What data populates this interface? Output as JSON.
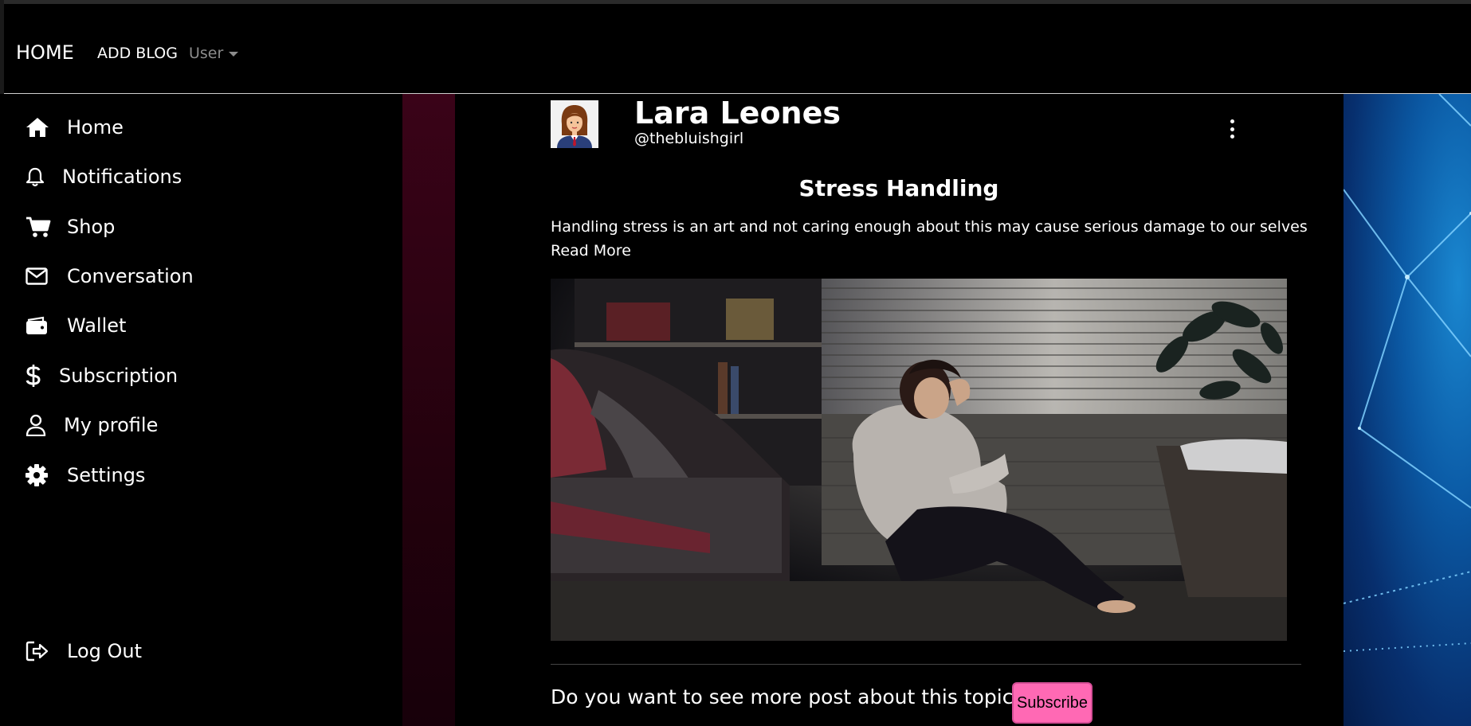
{
  "navbar": {
    "home_label": "HOME",
    "add_blog_label": "ADD BLOG",
    "user_menu_label": "User"
  },
  "sidebar": {
    "items": [
      {
        "label": "Home",
        "icon": "home-icon"
      },
      {
        "label": "Notifications",
        "icon": "bell-icon"
      },
      {
        "label": "Shop",
        "icon": "cart-icon"
      },
      {
        "label": "Conversation",
        "icon": "envelope-icon"
      },
      {
        "label": "Wallet",
        "icon": "wallet-icon"
      },
      {
        "label": "Subscription",
        "icon": "dollar-icon"
      },
      {
        "label": "My profile",
        "icon": "user-icon"
      },
      {
        "label": "Settings",
        "icon": "gear-icon"
      }
    ],
    "logout": {
      "label": "Log Out",
      "icon": "sign-out-icon"
    }
  },
  "post": {
    "author_name": "Lara Leones",
    "author_handle": "@thebluishgirl",
    "title": "Stress Handling",
    "excerpt": "Handling stress is an art and not caring enough about this may cause serious damage to our selves",
    "read_more_label": "Read More",
    "cta_text": "Do you want to see more post about this topic??",
    "subscribe_label": "Subscribe"
  },
  "colors": {
    "subscribe_bg": "#ff69b4",
    "background": "#000000",
    "user_menu": "#8c8c8c"
  }
}
